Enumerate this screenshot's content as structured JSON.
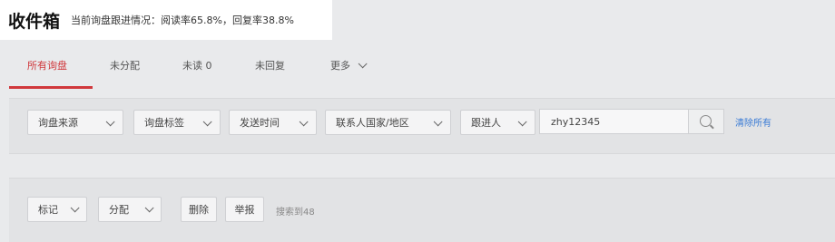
{
  "header": {
    "title": "收件箱",
    "subtitle": "当前询盘跟进情况：阅读率65.8%，回复率38.8%"
  },
  "tabs": [
    {
      "label": "所有询盘",
      "active": true
    },
    {
      "label": "未分配"
    },
    {
      "label": "未读 0"
    },
    {
      "label": "未回复"
    },
    {
      "label": "更多"
    }
  ],
  "filters": {
    "dropdowns": [
      {
        "label": "询盘来源"
      },
      {
        "label": "询盘标签"
      },
      {
        "label": "发送时间"
      },
      {
        "label": "联系人国家/地区"
      },
      {
        "label": "跟进人"
      }
    ],
    "search": {
      "value": "zhy12345"
    },
    "clear_label": "清除所有"
  },
  "actions": {
    "buttons": [
      {
        "label": "标记"
      },
      {
        "label": "分配"
      },
      {
        "label": "删除"
      },
      {
        "label": "举报"
      }
    ],
    "result_text": "搜索到48"
  },
  "colors": {
    "accent": "#d0383c",
    "link": "#3a7bd5"
  }
}
